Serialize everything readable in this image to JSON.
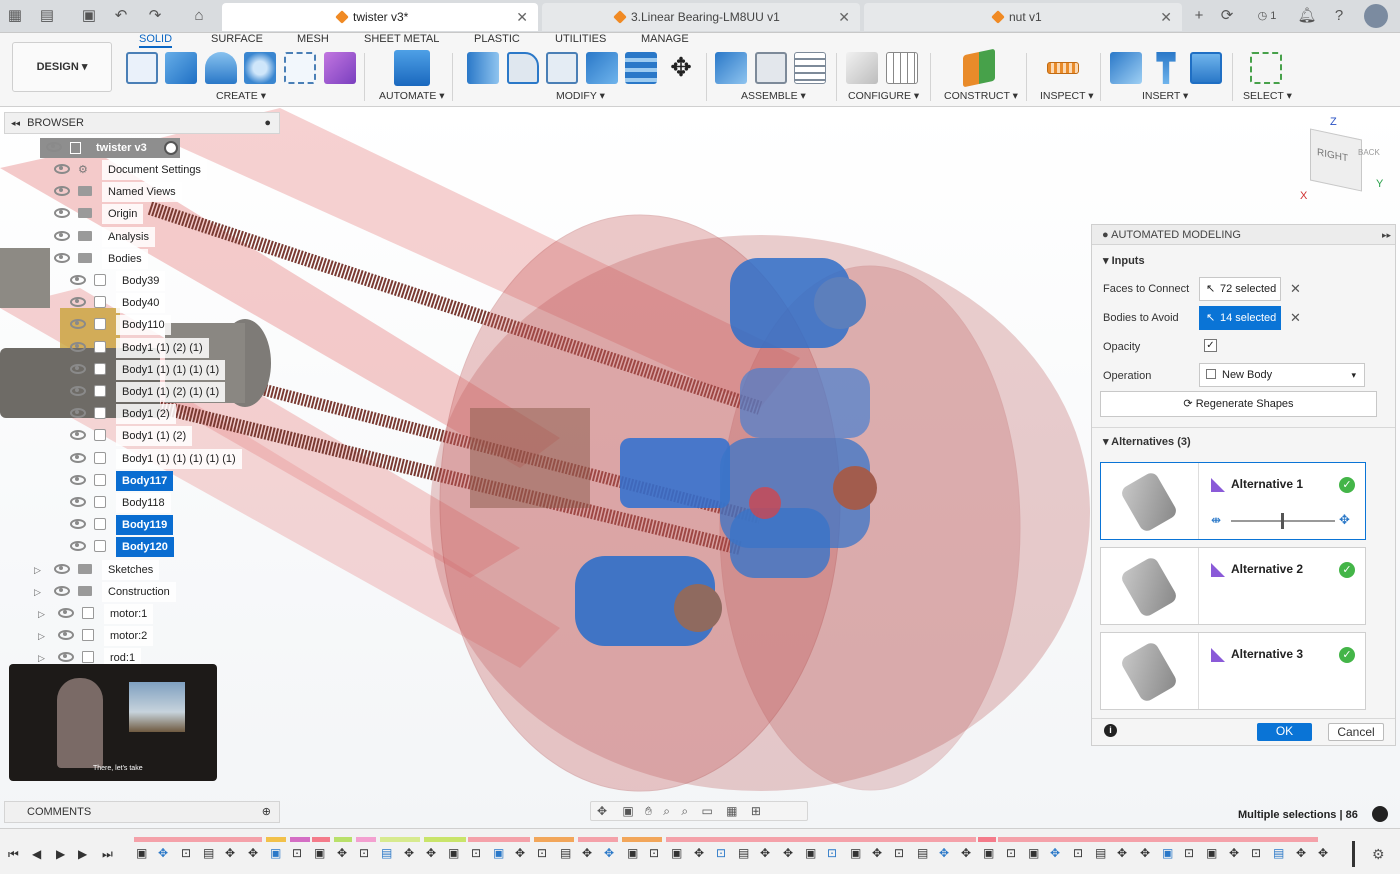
{
  "tabs": [
    {
      "label": "twister v3*",
      "active": true
    },
    {
      "label": "3.Linear Bearing-LM8UU v1",
      "active": false
    },
    {
      "label": "nut v1",
      "active": false
    }
  ],
  "tabbar_right": {
    "count": "1"
  },
  "toolbar": {
    "workspace": "DESIGN",
    "workspace_tabs": [
      "SOLID",
      "SURFACE",
      "MESH",
      "SHEET METAL",
      "PLASTIC",
      "UTILITIES",
      "MANAGE"
    ],
    "groups": [
      "CREATE",
      "AUTOMATE",
      "MODIFY",
      "ASSEMBLE",
      "CONFIGURE",
      "CONSTRUCT",
      "INSPECT",
      "INSERT",
      "SELECT"
    ]
  },
  "browser": {
    "title": "BROWSER",
    "root": "twister v3",
    "items": [
      {
        "label": "Document Settings",
        "kind": "settings"
      },
      {
        "label": "Named Views",
        "kind": "folder"
      },
      {
        "label": "Origin",
        "kind": "folder"
      },
      {
        "label": "Analysis",
        "kind": "folder"
      },
      {
        "label": "Bodies",
        "kind": "folder"
      },
      {
        "label": "Body39",
        "kind": "body"
      },
      {
        "label": "Body40",
        "kind": "body"
      },
      {
        "label": "Body110",
        "kind": "body"
      },
      {
        "label": "Body1 (1) (2) (1)",
        "kind": "body"
      },
      {
        "label": "Body1 (1) (1) (1) (1)",
        "kind": "body"
      },
      {
        "label": "Body1 (1) (2) (1) (1)",
        "kind": "body"
      },
      {
        "label": "Body1 (2)",
        "kind": "body"
      },
      {
        "label": "Body1 (1) (2)",
        "kind": "body"
      },
      {
        "label": "Body1 (1) (1) (1) (1) (1)",
        "kind": "body"
      },
      {
        "label": "Body117",
        "kind": "body",
        "selected": true
      },
      {
        "label": "Body118",
        "kind": "body"
      },
      {
        "label": "Body119",
        "kind": "body",
        "selected": true
      },
      {
        "label": "Body120",
        "kind": "body",
        "selected": true
      },
      {
        "label": "Sketches",
        "kind": "folder"
      },
      {
        "label": "Construction",
        "kind": "folder"
      },
      {
        "label": "motor:1",
        "kind": "component"
      },
      {
        "label": "motor:2",
        "kind": "component"
      },
      {
        "label": "rod:1",
        "kind": "component"
      }
    ]
  },
  "video": {
    "caption": "There, let's take"
  },
  "viewcube": {
    "face": "RIGHT",
    "side": "BACK",
    "axes": [
      "Z",
      "X",
      "Y"
    ]
  },
  "automated_modeling": {
    "title": "AUTOMATED MODELING",
    "inputs_label": "Inputs",
    "faces_label": "Faces to Connect",
    "faces_value": "72 selected",
    "bodies_label": "Bodies to Avoid",
    "bodies_value": "14 selected",
    "opacity_label": "Opacity",
    "operation_label": "Operation",
    "operation_value": "New Body",
    "regenerate": "Regenerate Shapes",
    "alternatives_label": "Alternatives (3)",
    "alternatives": [
      "Alternative 1",
      "Alternative 2",
      "Alternative 3"
    ],
    "ok": "OK",
    "cancel": "Cancel"
  },
  "status": {
    "selection": "Multiple selections | 86"
  },
  "comments": {
    "label": "COMMENTS"
  },
  "colors": {
    "accent": "#0a74d6",
    "selected": "#0a6dd1",
    "success": "#44b548",
    "bar_pink": "#f4a1a9"
  }
}
